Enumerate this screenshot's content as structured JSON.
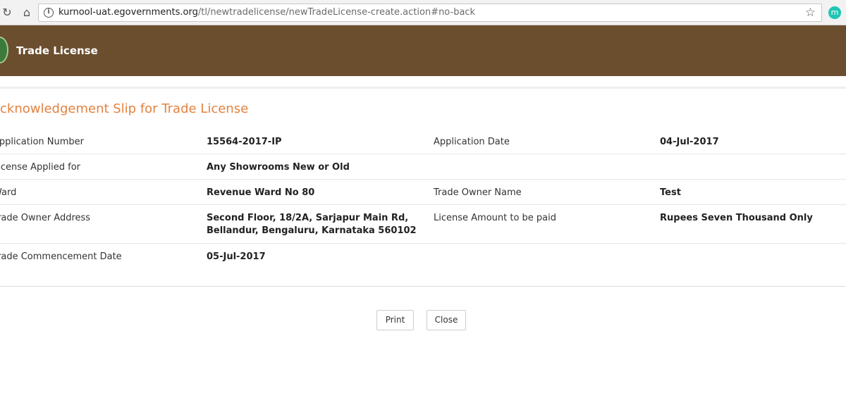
{
  "browser": {
    "url_host": "kurnool-uat.egovernments.org",
    "url_path": "/tl/newtradelicense/newTradeLicense-create.action#no-back",
    "extension_letter": "m"
  },
  "header": {
    "title": "Trade License",
    "background": "#6b4e2e"
  },
  "slip": {
    "title": "Acknowledgement Slip for Trade License",
    "title_color": "#e5813e",
    "rows": [
      {
        "label1": "Application Number",
        "value1": "15564-2017-IP",
        "label2": "Application Date",
        "value2": "04-Jul-2017"
      },
      {
        "label1": "License Applied for",
        "value1": "Any Showrooms New or Old",
        "label2": "",
        "value2": ""
      },
      {
        "label1": "Ward",
        "value1": "Revenue Ward No 80",
        "label2": "Trade Owner Name",
        "value2": "Test"
      },
      {
        "label1": "Trade Owner Address",
        "value1_line1": "Second Floor, 18/2A, Sarjapur Main Rd,",
        "value1_line2": "Bellandur, Bengaluru, Karnataka 560102",
        "label2": "License Amount to be paid",
        "value2": "Rupees Seven Thousand Only"
      },
      {
        "label1": "Trade Commencement Date",
        "value1": "05-Jul-2017",
        "label2": "",
        "value2": ""
      }
    ]
  },
  "buttons": {
    "print": "Print",
    "close": "Close"
  },
  "icons": {
    "reload": "reload-icon",
    "home": "home-icon",
    "info": "info-icon",
    "star": "star-icon"
  }
}
